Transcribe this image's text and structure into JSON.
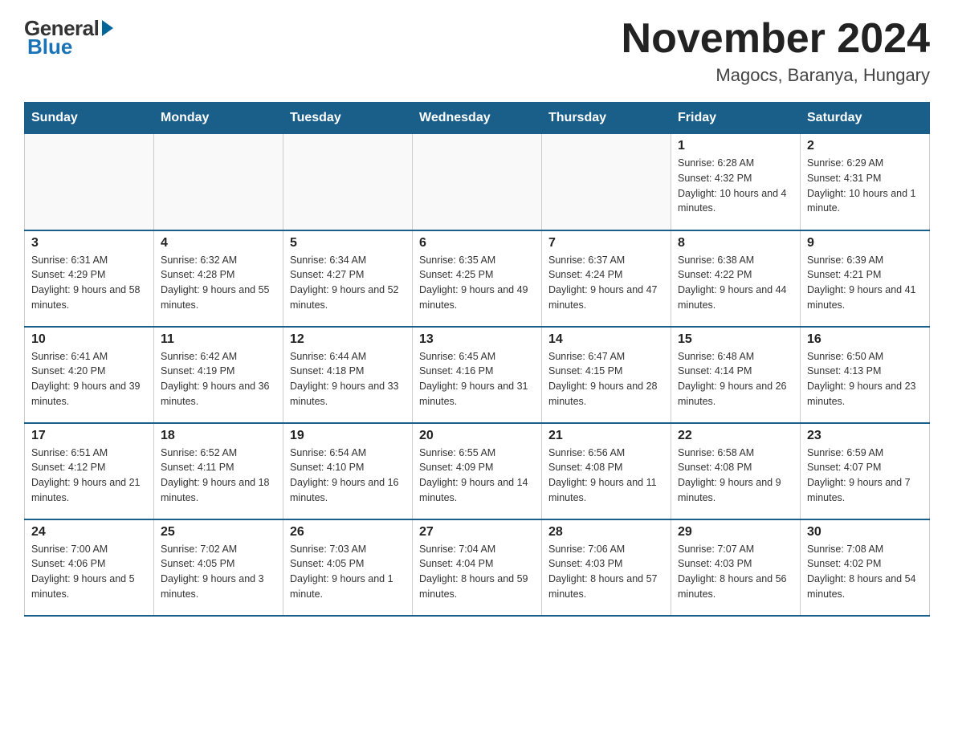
{
  "logo": {
    "general": "General",
    "blue": "Blue"
  },
  "title": "November 2024",
  "location": "Magocs, Baranya, Hungary",
  "days_of_week": [
    "Sunday",
    "Monday",
    "Tuesday",
    "Wednesday",
    "Thursday",
    "Friday",
    "Saturday"
  ],
  "weeks": [
    [
      {
        "day": "",
        "info": ""
      },
      {
        "day": "",
        "info": ""
      },
      {
        "day": "",
        "info": ""
      },
      {
        "day": "",
        "info": ""
      },
      {
        "day": "",
        "info": ""
      },
      {
        "day": "1",
        "info": "Sunrise: 6:28 AM\nSunset: 4:32 PM\nDaylight: 10 hours and 4 minutes."
      },
      {
        "day": "2",
        "info": "Sunrise: 6:29 AM\nSunset: 4:31 PM\nDaylight: 10 hours and 1 minute."
      }
    ],
    [
      {
        "day": "3",
        "info": "Sunrise: 6:31 AM\nSunset: 4:29 PM\nDaylight: 9 hours and 58 minutes."
      },
      {
        "day": "4",
        "info": "Sunrise: 6:32 AM\nSunset: 4:28 PM\nDaylight: 9 hours and 55 minutes."
      },
      {
        "day": "5",
        "info": "Sunrise: 6:34 AM\nSunset: 4:27 PM\nDaylight: 9 hours and 52 minutes."
      },
      {
        "day": "6",
        "info": "Sunrise: 6:35 AM\nSunset: 4:25 PM\nDaylight: 9 hours and 49 minutes."
      },
      {
        "day": "7",
        "info": "Sunrise: 6:37 AM\nSunset: 4:24 PM\nDaylight: 9 hours and 47 minutes."
      },
      {
        "day": "8",
        "info": "Sunrise: 6:38 AM\nSunset: 4:22 PM\nDaylight: 9 hours and 44 minutes."
      },
      {
        "day": "9",
        "info": "Sunrise: 6:39 AM\nSunset: 4:21 PM\nDaylight: 9 hours and 41 minutes."
      }
    ],
    [
      {
        "day": "10",
        "info": "Sunrise: 6:41 AM\nSunset: 4:20 PM\nDaylight: 9 hours and 39 minutes."
      },
      {
        "day": "11",
        "info": "Sunrise: 6:42 AM\nSunset: 4:19 PM\nDaylight: 9 hours and 36 minutes."
      },
      {
        "day": "12",
        "info": "Sunrise: 6:44 AM\nSunset: 4:18 PM\nDaylight: 9 hours and 33 minutes."
      },
      {
        "day": "13",
        "info": "Sunrise: 6:45 AM\nSunset: 4:16 PM\nDaylight: 9 hours and 31 minutes."
      },
      {
        "day": "14",
        "info": "Sunrise: 6:47 AM\nSunset: 4:15 PM\nDaylight: 9 hours and 28 minutes."
      },
      {
        "day": "15",
        "info": "Sunrise: 6:48 AM\nSunset: 4:14 PM\nDaylight: 9 hours and 26 minutes."
      },
      {
        "day": "16",
        "info": "Sunrise: 6:50 AM\nSunset: 4:13 PM\nDaylight: 9 hours and 23 minutes."
      }
    ],
    [
      {
        "day": "17",
        "info": "Sunrise: 6:51 AM\nSunset: 4:12 PM\nDaylight: 9 hours and 21 minutes."
      },
      {
        "day": "18",
        "info": "Sunrise: 6:52 AM\nSunset: 4:11 PM\nDaylight: 9 hours and 18 minutes."
      },
      {
        "day": "19",
        "info": "Sunrise: 6:54 AM\nSunset: 4:10 PM\nDaylight: 9 hours and 16 minutes."
      },
      {
        "day": "20",
        "info": "Sunrise: 6:55 AM\nSunset: 4:09 PM\nDaylight: 9 hours and 14 minutes."
      },
      {
        "day": "21",
        "info": "Sunrise: 6:56 AM\nSunset: 4:08 PM\nDaylight: 9 hours and 11 minutes."
      },
      {
        "day": "22",
        "info": "Sunrise: 6:58 AM\nSunset: 4:08 PM\nDaylight: 9 hours and 9 minutes."
      },
      {
        "day": "23",
        "info": "Sunrise: 6:59 AM\nSunset: 4:07 PM\nDaylight: 9 hours and 7 minutes."
      }
    ],
    [
      {
        "day": "24",
        "info": "Sunrise: 7:00 AM\nSunset: 4:06 PM\nDaylight: 9 hours and 5 minutes."
      },
      {
        "day": "25",
        "info": "Sunrise: 7:02 AM\nSunset: 4:05 PM\nDaylight: 9 hours and 3 minutes."
      },
      {
        "day": "26",
        "info": "Sunrise: 7:03 AM\nSunset: 4:05 PM\nDaylight: 9 hours and 1 minute."
      },
      {
        "day": "27",
        "info": "Sunrise: 7:04 AM\nSunset: 4:04 PM\nDaylight: 8 hours and 59 minutes."
      },
      {
        "day": "28",
        "info": "Sunrise: 7:06 AM\nSunset: 4:03 PM\nDaylight: 8 hours and 57 minutes."
      },
      {
        "day": "29",
        "info": "Sunrise: 7:07 AM\nSunset: 4:03 PM\nDaylight: 8 hours and 56 minutes."
      },
      {
        "day": "30",
        "info": "Sunrise: 7:08 AM\nSunset: 4:02 PM\nDaylight: 8 hours and 54 minutes."
      }
    ]
  ]
}
